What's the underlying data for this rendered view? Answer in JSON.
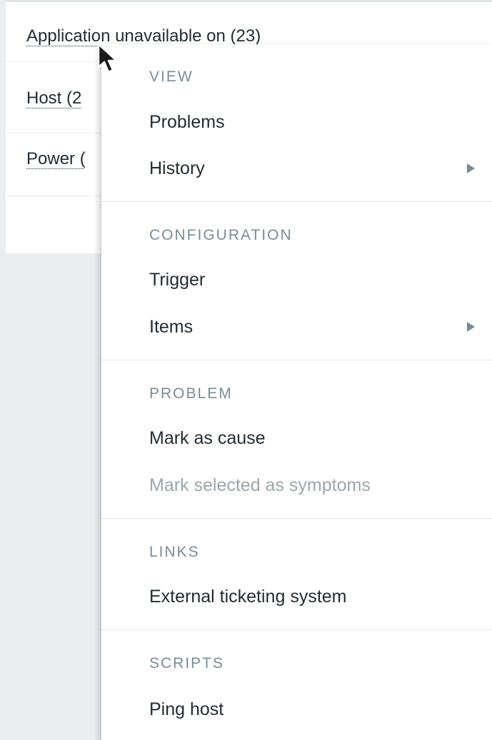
{
  "list": {
    "rows": [
      {
        "label": "Application unavailable on (23)"
      },
      {
        "label": "Host (2"
      },
      {
        "label": "Power ("
      }
    ]
  },
  "context_menu": {
    "view": {
      "header": "VIEW",
      "items": [
        "Problems",
        "History"
      ]
    },
    "configuration": {
      "header": "CONFIGURATION",
      "items": [
        "Trigger",
        "Items"
      ]
    },
    "problem": {
      "header": "PROBLEM",
      "items": [
        "Mark as cause",
        "Mark selected as symptoms"
      ]
    },
    "links": {
      "header": "LINKS",
      "items": [
        "External ticketing system"
      ]
    },
    "scripts": {
      "header": "SCRIPTS",
      "items": [
        "Ping host"
      ]
    }
  },
  "icons": {
    "submenu": "chevron-right-icon",
    "pointer": "mouse-pointer-icon"
  },
  "colors": {
    "text": "#1f2c33",
    "section_header": "#768d99",
    "disabled": "#9aa7ae",
    "background": "#ebeef0"
  }
}
